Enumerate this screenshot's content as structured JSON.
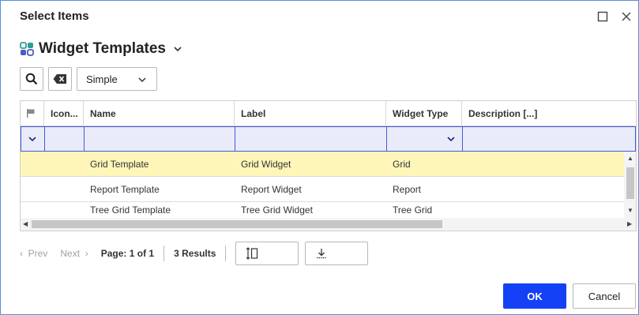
{
  "dialog": {
    "title": "Select Items"
  },
  "header": {
    "title": "Widget Templates",
    "icon": "widget-grid-icon"
  },
  "toolbar": {
    "search_icon": "search-icon",
    "clear_icon": "clear-filter-icon",
    "view_select": {
      "selected": "Simple"
    }
  },
  "grid": {
    "columns": [
      "Icon...",
      "Name",
      "Label",
      "Widget Type",
      "Description [...]"
    ],
    "rows": [
      {
        "name": "Grid Template",
        "label": "Grid Widget",
        "type": "Grid",
        "selected": true
      },
      {
        "name": "Report Template",
        "label": "Report Widget",
        "type": "Report",
        "selected": false
      },
      {
        "name": "Tree Grid Template",
        "label": "Tree Grid Widget",
        "type": "Tree Grid",
        "selected": false
      }
    ]
  },
  "pager": {
    "prev": "Prev",
    "next": "Next",
    "page_info": "Page: 1 of 1",
    "results": "3 Results"
  },
  "buttons": {
    "ok": "OK",
    "cancel": "Cancel"
  },
  "colors": {
    "accent": "#1441f5",
    "selected_row": "#fdf6b8",
    "filter_row": "#e9ecf8",
    "filter_border": "#4458d9"
  }
}
